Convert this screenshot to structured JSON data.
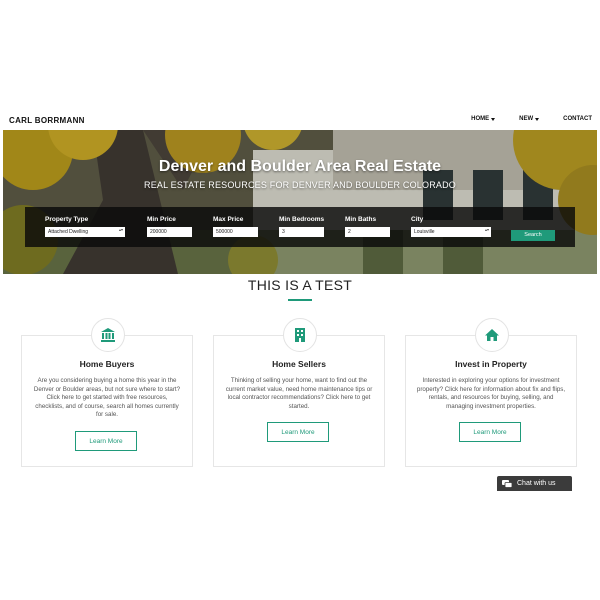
{
  "header": {
    "brand": "CARL BORRMANN",
    "nav": [
      {
        "label": "HOME",
        "has_dropdown": true
      },
      {
        "label": "NEW",
        "has_dropdown": true
      },
      {
        "label": "CONTACT",
        "has_dropdown": false
      }
    ]
  },
  "hero": {
    "title": "Denver and Boulder Area Real Estate",
    "subtitle": "REAL ESTATE RESOURCES FOR DENVER AND BOULDER COLORADO"
  },
  "search": {
    "fields": [
      {
        "label": "Property Type",
        "value": "Attached Dwelling",
        "type": "select"
      },
      {
        "label": "Min Price",
        "value": "200000",
        "type": "input"
      },
      {
        "label": "Max Price",
        "value": "500000",
        "type": "input"
      },
      {
        "label": "Min Bedrooms",
        "value": "3",
        "type": "input"
      },
      {
        "label": "Min Baths",
        "value": "2",
        "type": "input"
      },
      {
        "label": "City",
        "value": "Louisville",
        "type": "select"
      }
    ],
    "button_label": "Search"
  },
  "section": {
    "title": "THIS IS A TEST"
  },
  "cards": [
    {
      "icon": "bank-icon",
      "title": "Home Buyers",
      "text": "Are you considering buying a home this year in the Denver or Boulder areas, but not sure where to start? Click here to get started with free resources, checklists, and of course, search all homes currently for sale.",
      "button": "Learn More"
    },
    {
      "icon": "building-icon",
      "title": "Home Sellers",
      "text": "Thinking of selling your home, want to find out the current market value, need home maintenance tips or local contractor recommendations? Click here to get started.",
      "button": "Learn More"
    },
    {
      "icon": "home-icon",
      "title": "Invest in Property",
      "text": "Interested in exploring your options for investment property? Click here for information about fix and flips, rentals, and resources for buying, selling, and managing investment properties.",
      "button": "Learn More"
    }
  ],
  "chat": {
    "label": "Chat with us"
  },
  "colors": {
    "accent": "#1f9a7a",
    "panel": "#0a0a0a",
    "chat_bg": "#3b3b3b"
  }
}
